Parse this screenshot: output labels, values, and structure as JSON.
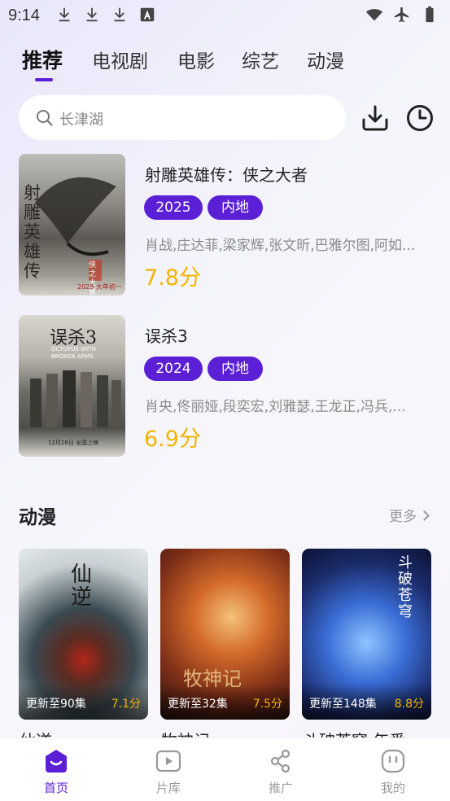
{
  "status": {
    "time": "9:14",
    "left_icons": [
      "download-icon",
      "download-icon",
      "download-icon",
      "font-a-icon"
    ],
    "right_icons": [
      "wifi-icon",
      "airplane-icon",
      "battery-icon"
    ]
  },
  "tabs": [
    {
      "label": "推荐",
      "active": true
    },
    {
      "label": "电视剧",
      "active": false
    },
    {
      "label": "电影",
      "active": false
    },
    {
      "label": "综艺",
      "active": false
    },
    {
      "label": "动漫",
      "active": false
    }
  ],
  "search": {
    "placeholder": "长津湖"
  },
  "actions": {
    "download_icon": "download-icon",
    "history_icon": "clock-icon"
  },
  "movies": [
    {
      "title": "射雕英雄传：侠之大者",
      "year": "2025",
      "region": "内地",
      "cast": "肖战,庄达菲,梁家辉,张文昕,巴雅尔图,阿如...",
      "score": "7.8分",
      "poster_text": [
        "射雕英雄传",
        "侠之大者",
        "2025 大年初一"
      ]
    },
    {
      "title": "误杀3",
      "year": "2024",
      "region": "内地",
      "cast": "肖央,佟丽娅,段奕宏,刘雅瑟,王龙正,冯兵,...",
      "score": "6.9分",
      "poster_text": [
        "误杀3",
        "OCTOPUS WITH BROKEN ARMS",
        "12月28日 全国上映"
      ]
    }
  ],
  "anime_section": {
    "title": "动漫",
    "more": "更多"
  },
  "anime": [
    {
      "title": "仙逆",
      "episode": "更新至90集",
      "score": "7.1分",
      "poster_text": "仙逆"
    },
    {
      "title": "牧神记",
      "episode": "更新至32集",
      "score": "7.5分",
      "poster_text": "牧神记"
    },
    {
      "title": "斗破苍穹 年番",
      "episode": "更新至148集",
      "score": "8.8分",
      "poster_text": "斗破苍穹"
    }
  ],
  "bottom_nav": [
    {
      "label": "首页",
      "icon": "home-icon",
      "active": true
    },
    {
      "label": "片库",
      "icon": "play-icon",
      "active": false
    },
    {
      "label": "推广",
      "icon": "share-icon",
      "active": false
    },
    {
      "label": "我的",
      "icon": "profile-icon",
      "active": false
    }
  ],
  "colors": {
    "accent": "#5b1fd6",
    "score": "#f3b400"
  }
}
